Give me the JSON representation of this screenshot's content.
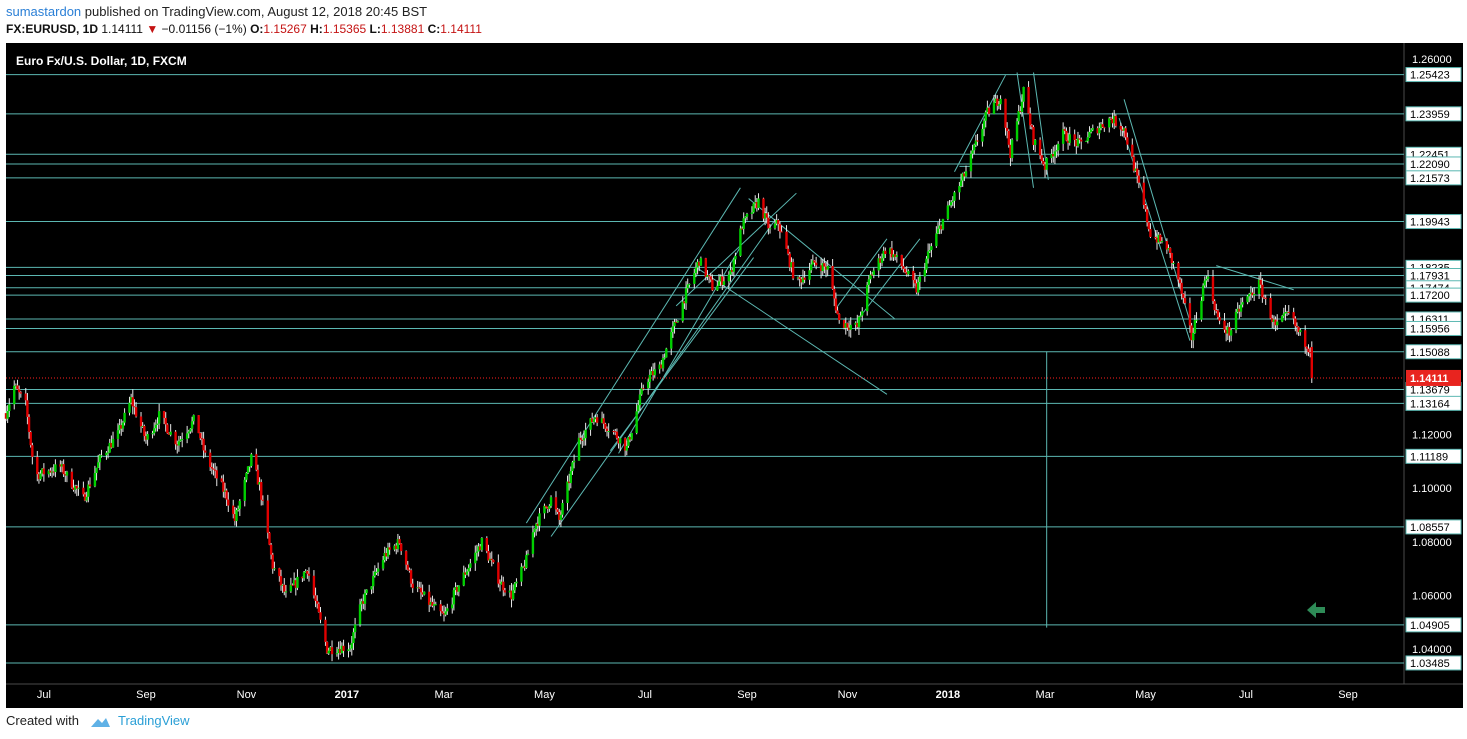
{
  "header": {
    "author": "sumastardon",
    "published": "published on TradingView.com, August 12, 2018 20:45 BST",
    "symbol": "FX:EURUSD, 1D",
    "last": "1.14111",
    "change": "−0.01156 (−1%)",
    "open_label": "O:",
    "open": "1.15267",
    "high_label": "H:",
    "high": "1.15365",
    "low_label": "L:",
    "low": "1.13881",
    "close_label": "C:",
    "close": "1.14111"
  },
  "footer": {
    "created_with": "Created with",
    "brand": "TradingView"
  },
  "chart_data": {
    "type": "candlestick",
    "title": "Euro Fx/U.S. Dollar, 1D, FXCM",
    "symbol": "EURUSD",
    "timeframe": "1D",
    "ylim": [
      1.027,
      1.266
    ],
    "xlim": [
      "2016-06-08",
      "2018-10-05"
    ],
    "y_ticks": [
      "1.26000",
      "1.12000",
      "1.10000",
      "1.08000",
      "1.06000",
      "1.04000"
    ],
    "x_ticks": [
      {
        "label": "Jul",
        "date": "2016-07-01",
        "bold": false
      },
      {
        "label": "Sep",
        "date": "2016-09-01",
        "bold": false
      },
      {
        "label": "Nov",
        "date": "2016-11-01",
        "bold": false
      },
      {
        "label": "2017",
        "date": "2017-01-01",
        "bold": true
      },
      {
        "label": "Mar",
        "date": "2017-03-01",
        "bold": false
      },
      {
        "label": "May",
        "date": "2017-05-01",
        "bold": false
      },
      {
        "label": "Jul",
        "date": "2017-07-01",
        "bold": false
      },
      {
        "label": "Sep",
        "date": "2017-09-01",
        "bold": false
      },
      {
        "label": "Nov",
        "date": "2017-11-01",
        "bold": false
      },
      {
        "label": "2018",
        "date": "2018-01-01",
        "bold": true
      },
      {
        "label": "Mar",
        "date": "2018-03-01",
        "bold": false
      },
      {
        "label": "May",
        "date": "2018-05-01",
        "bold": false
      },
      {
        "label": "Jul",
        "date": "2018-07-01",
        "bold": false
      },
      {
        "label": "Sep",
        "date": "2018-09-01",
        "bold": false
      }
    ],
    "horizontal_levels": [
      "1.25423",
      "1.23959",
      "1.22451",
      "1.22090",
      "1.21573",
      "1.19943",
      "1.18235",
      "1.17931",
      "1.17474",
      "1.17200",
      "1.16311",
      "1.15956",
      "1.15088",
      "1.13679",
      "1.13164",
      "1.11189",
      "1.08557",
      "1.04905",
      "1.03485"
    ],
    "last_price": "1.14111",
    "waypoints": [
      [
        "2016-06-08",
        1.128
      ],
      [
        "2016-06-13",
        1.138
      ],
      [
        "2016-06-20",
        1.131
      ],
      [
        "2016-06-24",
        1.112
      ],
      [
        "2016-06-27",
        1.105
      ],
      [
        "2016-07-11",
        1.108
      ],
      [
        "2016-07-25",
        1.096
      ],
      [
        "2016-08-05",
        1.112
      ],
      [
        "2016-08-15",
        1.12
      ],
      [
        "2016-08-23",
        1.133
      ],
      [
        "2016-09-01",
        1.118
      ],
      [
        "2016-09-09",
        1.127
      ],
      [
        "2016-09-20",
        1.117
      ],
      [
        "2016-10-01",
        1.126
      ],
      [
        "2016-10-07",
        1.112
      ],
      [
        "2016-10-20",
        1.097
      ],
      [
        "2016-10-25",
        1.088
      ],
      [
        "2016-11-04",
        1.111
      ],
      [
        "2016-11-09",
        1.101
      ],
      [
        "2016-11-17",
        1.071
      ],
      [
        "2016-11-25",
        1.06
      ],
      [
        "2016-12-08",
        1.07
      ],
      [
        "2016-12-20",
        1.04
      ],
      [
        "2017-01-03",
        1.041
      ],
      [
        "2017-01-10",
        1.057
      ],
      [
        "2017-01-24",
        1.075
      ],
      [
        "2017-02-02",
        1.08
      ],
      [
        "2017-02-10",
        1.064
      ],
      [
        "2017-02-22",
        1.056
      ],
      [
        "2017-03-01",
        1.052
      ],
      [
        "2017-03-10",
        1.064
      ],
      [
        "2017-03-24",
        1.08
      ],
      [
        "2017-04-04",
        1.065
      ],
      [
        "2017-04-11",
        1.06
      ],
      [
        "2017-04-20",
        1.073
      ],
      [
        "2017-04-25",
        1.086
      ],
      [
        "2017-05-05",
        1.096
      ],
      [
        "2017-05-10",
        1.088
      ],
      [
        "2017-05-22",
        1.118
      ],
      [
        "2017-06-01",
        1.127
      ],
      [
        "2017-06-12",
        1.121
      ],
      [
        "2017-06-20",
        1.115
      ],
      [
        "2017-07-01",
        1.14
      ],
      [
        "2017-07-10",
        1.145
      ],
      [
        "2017-07-25",
        1.171
      ],
      [
        "2017-08-03",
        1.185
      ],
      [
        "2017-08-11",
        1.175
      ],
      [
        "2017-08-22",
        1.18
      ],
      [
        "2017-08-29",
        1.198
      ],
      [
        "2017-09-08",
        1.207
      ],
      [
        "2017-09-15",
        1.196
      ],
      [
        "2017-09-20",
        1.199
      ],
      [
        "2017-10-01",
        1.176
      ],
      [
        "2017-10-12",
        1.184
      ],
      [
        "2017-10-20",
        1.182
      ],
      [
        "2017-10-27",
        1.162
      ],
      [
        "2017-11-07",
        1.16
      ],
      [
        "2017-11-15",
        1.179
      ],
      [
        "2017-11-25",
        1.19
      ],
      [
        "2017-12-05",
        1.182
      ],
      [
        "2017-12-13",
        1.174
      ],
      [
        "2017-12-20",
        1.187
      ],
      [
        "2017-12-29",
        1.2
      ],
      [
        "2018-01-12",
        1.218
      ],
      [
        "2018-01-25",
        1.24
      ],
      [
        "2018-02-02",
        1.246
      ],
      [
        "2018-02-08",
        1.225
      ],
      [
        "2018-02-16",
        1.248
      ],
      [
        "2018-02-22",
        1.23
      ],
      [
        "2018-03-01",
        1.22
      ],
      [
        "2018-03-12",
        1.232
      ],
      [
        "2018-03-22",
        1.228
      ],
      [
        "2018-03-28",
        1.232
      ],
      [
        "2018-04-10",
        1.238
      ],
      [
        "2018-04-18",
        1.234
      ],
      [
        "2018-04-24",
        1.22
      ],
      [
        "2018-05-04",
        1.195
      ],
      [
        "2018-05-14",
        1.19
      ],
      [
        "2018-05-21",
        1.178
      ],
      [
        "2018-05-29",
        1.156
      ],
      [
        "2018-06-07",
        1.18
      ],
      [
        "2018-06-15",
        1.161
      ],
      [
        "2018-06-21",
        1.158
      ],
      [
        "2018-06-28",
        1.168
      ],
      [
        "2018-07-09",
        1.176
      ],
      [
        "2018-07-19",
        1.16
      ],
      [
        "2018-07-27",
        1.165
      ],
      [
        "2018-08-03",
        1.157
      ],
      [
        "2018-08-09",
        1.152
      ],
      [
        "2018-08-10",
        1.141
      ]
    ],
    "trendlines": [
      [
        [
          "2017-04-20",
          1.087
        ],
        [
          "2017-08-28",
          1.212
        ]
      ],
      [
        [
          "2017-05-05",
          1.082
        ],
        [
          "2017-09-18",
          1.2
        ]
      ],
      [
        [
          "2017-06-15",
          1.113
        ],
        [
          "2017-08-28",
          1.19
        ]
      ],
      [
        [
          "2017-06-10",
          1.114
        ],
        [
          "2017-09-05",
          1.186
        ]
      ],
      [
        [
          "2017-07-20",
          1.168
        ],
        [
          "2017-10-01",
          1.21
        ]
      ],
      [
        [
          "2017-08-02",
          1.182
        ],
        [
          "2017-11-25",
          1.135
        ]
      ],
      [
        [
          "2017-09-02",
          1.208
        ],
        [
          "2017-11-30",
          1.163
        ]
      ],
      [
        [
          "2017-10-25",
          1.167
        ],
        [
          "2017-11-25",
          1.193
        ]
      ],
      [
        [
          "2017-11-10",
          1.165
        ],
        [
          "2017-12-15",
          1.193
        ]
      ],
      [
        [
          "2018-01-08",
          1.22
        ],
        [
          "2018-01-15",
          1.22
        ]
      ],
      [
        [
          "2018-01-05",
          1.218
        ],
        [
          "2018-02-05",
          1.254
        ]
      ],
      [
        [
          "2018-02-12",
          1.255
        ],
        [
          "2018-02-22",
          1.212
        ]
      ],
      [
        [
          "2018-02-22",
          1.255
        ],
        [
          "2018-03-03",
          1.215
        ]
      ],
      [
        [
          "2018-04-18",
          1.245
        ],
        [
          "2018-05-30",
          1.158
        ]
      ],
      [
        [
          "2018-04-15",
          1.238
        ],
        [
          "2018-05-28",
          1.155
        ]
      ],
      [
        [
          "2018-06-13",
          1.183
        ],
        [
          "2018-07-30",
          1.174
        ]
      ]
    ],
    "vertical_line": [
      [
        "2018-03-02",
        1.151
      ],
      [
        "2018-03-02",
        1.048
      ]
    ],
    "grid": false,
    "legend": "none"
  }
}
